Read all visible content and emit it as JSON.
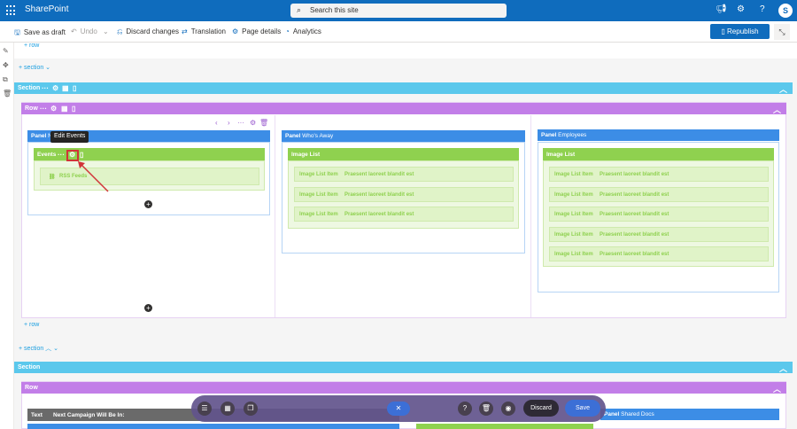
{
  "app": {
    "brand": "SharePoint",
    "search_placeholder": "Search this site",
    "avatar_initial": "S"
  },
  "commands": {
    "save_draft": "Save as draft",
    "undo": "Undo",
    "discard_changes": "Discard changes",
    "translation": "Translation",
    "page_details": "Page details",
    "analytics": "Analytics",
    "republish": "Republish"
  },
  "editor": {
    "add_row": "row",
    "add_section": "section",
    "section_label": "Section",
    "row_label": "Row",
    "tooltip": "Edit Events",
    "panels": [
      {
        "label": "Panel",
        "name": "N"
      },
      {
        "label": "Panel",
        "name": "Who's Away"
      },
      {
        "label": "Panel",
        "name": "Employees"
      }
    ],
    "events": {
      "label": "Events",
      "rss_label": "RSS Feeds"
    },
    "image_list": {
      "label": "Image List",
      "item_label": "Image List Item",
      "item_text": "Praesent laoreet blandit est"
    },
    "bottom": {
      "text_label": "Text",
      "campaign_title": "Next Campaign Will Be In:",
      "shared_docs_label": "Panel",
      "shared_docs_name": "Shared Docs"
    }
  },
  "dock": {
    "discard": "Discard",
    "save": "Save"
  },
  "colors": {
    "section": "#5bc8ec",
    "row": "#c27ee8",
    "panel": "#3c8de6",
    "webpart": "#8fd14f",
    "accent": "#0f6cbd"
  }
}
